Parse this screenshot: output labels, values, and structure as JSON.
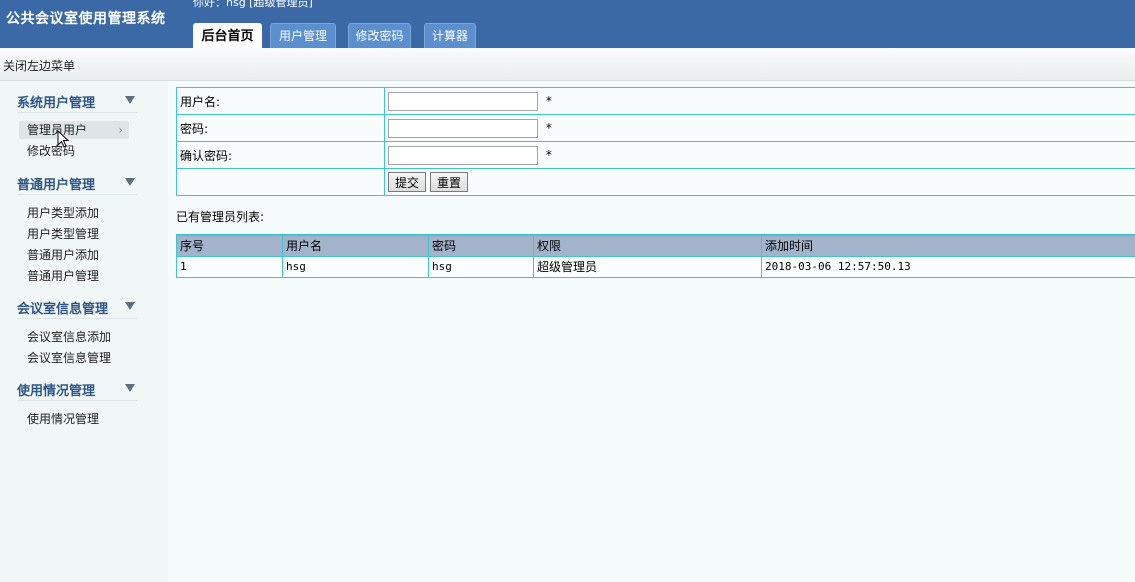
{
  "header": {
    "title": "公共会议室使用管理系统",
    "greeting": "你好：hsg [超级管理员]",
    "tabs": [
      {
        "label": "后台首页",
        "active": true
      },
      {
        "label": "用户管理",
        "active": false
      },
      {
        "label": "修改密码",
        "active": false
      },
      {
        "label": "计算器",
        "active": false
      }
    ]
  },
  "subbar": {
    "toggle_menu": "关闭左边菜单"
  },
  "sidebar": {
    "groups": [
      {
        "title": "系统用户管理",
        "items": [
          "管理员用户",
          "修改密码"
        ]
      },
      {
        "title": "普通用户管理",
        "items": [
          "用户类型添加",
          "用户类型管理",
          "普通用户添加",
          "普通用户管理"
        ]
      },
      {
        "title": "会议室信息管理",
        "items": [
          "会议室信息添加",
          "会议室信息管理"
        ]
      },
      {
        "title": "使用情况管理",
        "items": [
          "使用情况管理"
        ]
      }
    ],
    "active_item": "管理员用户"
  },
  "form": {
    "username_label": "用户名:",
    "password_label": "密码:",
    "confirm_label": "确认密码:",
    "username_value": "",
    "password_value": "",
    "confirm_value": "",
    "required_mark": "*",
    "submit_label": "提交",
    "reset_label": "重置"
  },
  "list": {
    "caption": "已有管理员列表:",
    "columns": [
      "序号",
      "用户名",
      "密码",
      "权限",
      "添加时间"
    ],
    "rows": [
      [
        "1",
        "hsg",
        "hsg",
        "超级管理员",
        "2018-03-06 12:57:50.13"
      ]
    ]
  },
  "colors": {
    "header_bg": "#3a69a5",
    "tab_bg": "#5b8fce",
    "border_cyan": "#41c4d0",
    "table_head_bg": "#a3b3cb",
    "sidebar_title": "#2f5585"
  }
}
